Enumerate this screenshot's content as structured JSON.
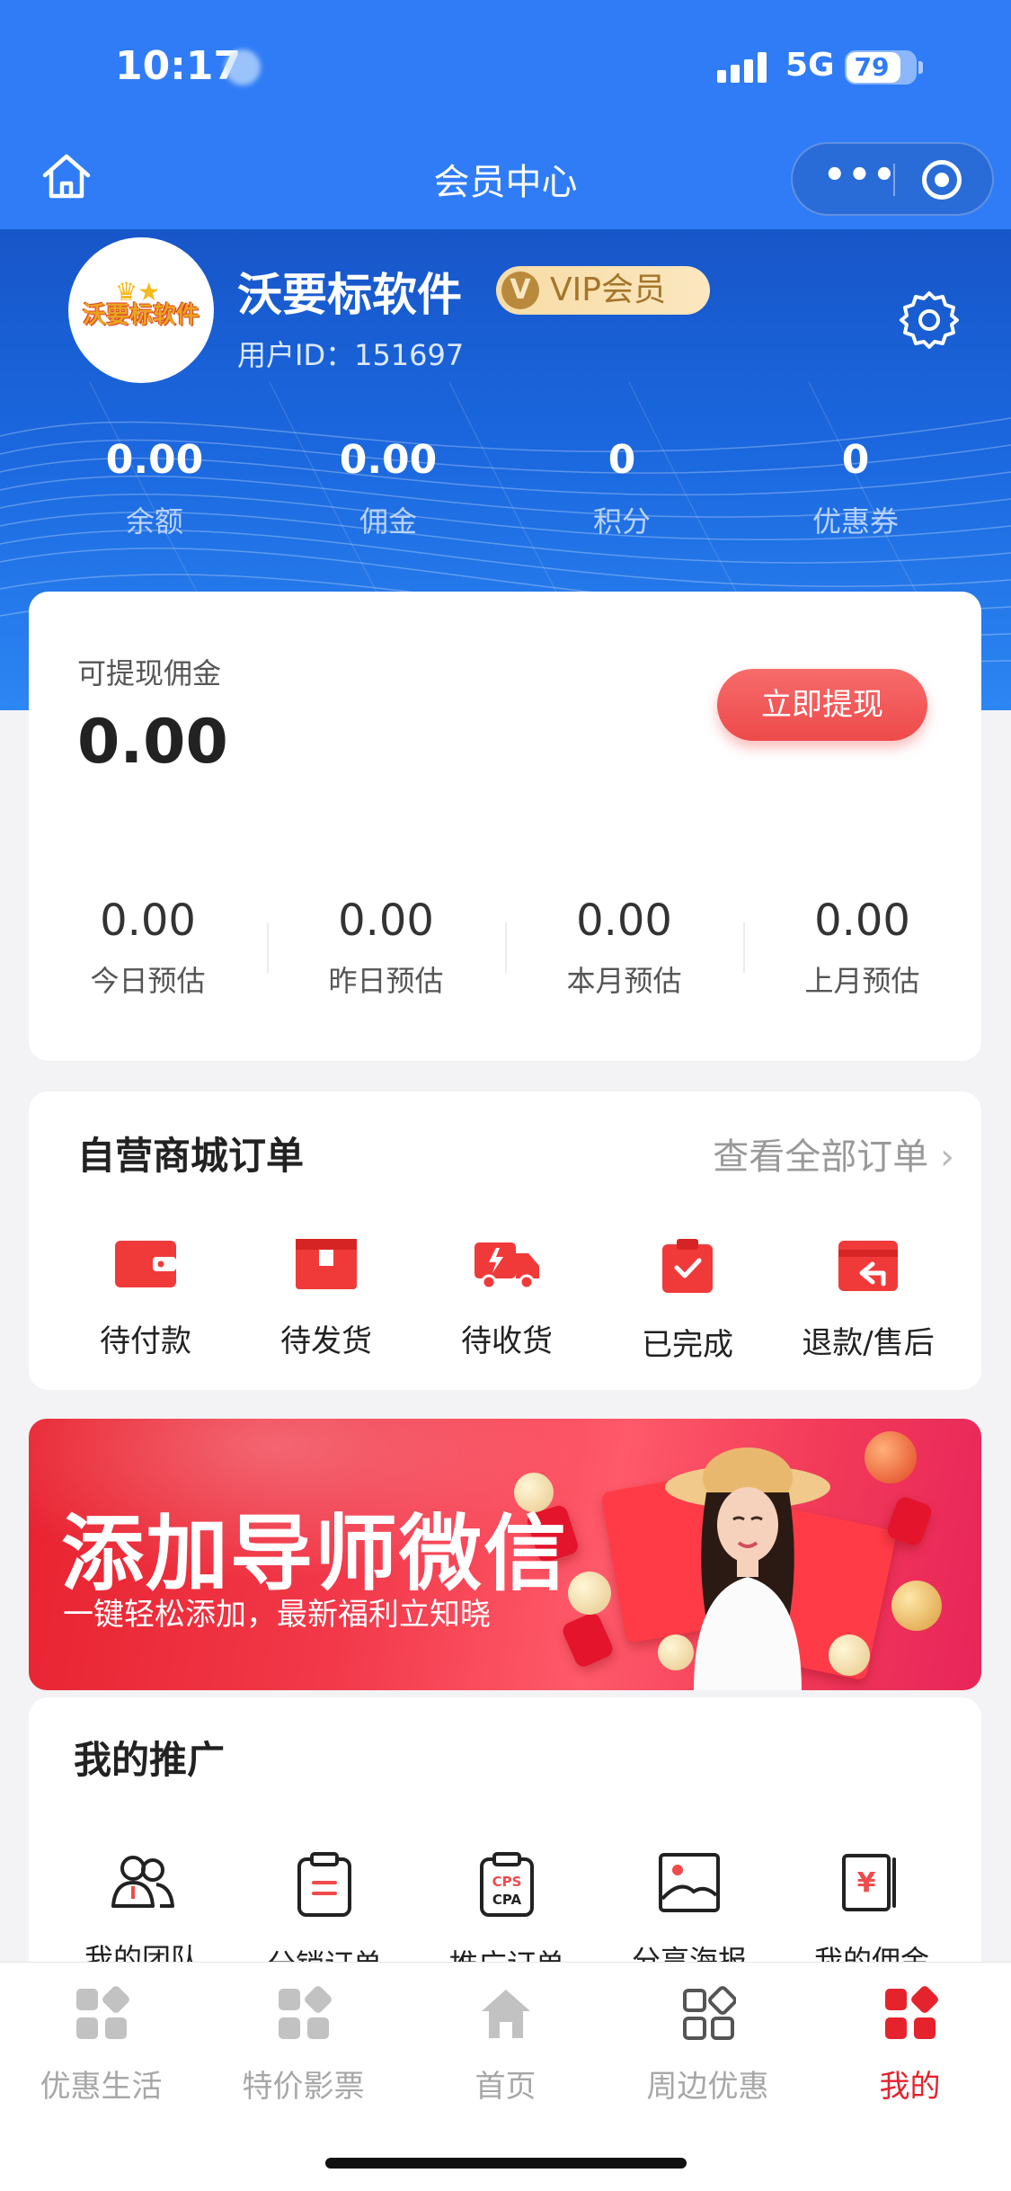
{
  "status_bar": {
    "time": "10:17",
    "network": "5G",
    "battery": "79",
    "battery_level": 0.79
  },
  "header": {
    "title": "会员中心"
  },
  "profile": {
    "avatar_text": "沃要标软件",
    "name": "沃要标软件",
    "vip_label": "VIP会员",
    "vip_letter": "V",
    "user_id": "用户ID：151697"
  },
  "stats": [
    {
      "value": "0.00",
      "label": "余额"
    },
    {
      "value": "0.00",
      "label": "佣金"
    },
    {
      "value": "0",
      "label": "积分"
    },
    {
      "value": "0",
      "label": "优惠券"
    }
  ],
  "commission": {
    "label": "可提现佣金",
    "amount": "0.00",
    "withdraw_button": "立即提现",
    "estimates": [
      {
        "value": "0.00",
        "label": "今日预估"
      },
      {
        "value": "0.00",
        "label": "昨日预估"
      },
      {
        "value": "0.00",
        "label": "本月预估"
      },
      {
        "value": "0.00",
        "label": "上月预估"
      }
    ]
  },
  "orders": {
    "title": "自营商城订单",
    "view_all": "查看全部订单",
    "items": [
      {
        "label": "待付款",
        "icon": "wallet-icon"
      },
      {
        "label": "待发货",
        "icon": "box-icon"
      },
      {
        "label": "待收货",
        "icon": "truck-icon"
      },
      {
        "label": "已完成",
        "icon": "clipboard-check-icon"
      },
      {
        "label": "退款/售后",
        "icon": "refund-icon"
      }
    ]
  },
  "banner": {
    "title": "添加导师微信",
    "subtitle": "一键轻松添加，最新福利立知晓"
  },
  "promotion": {
    "title": "我的推广",
    "items": [
      {
        "label": "我的团队",
        "icon": "team-icon"
      },
      {
        "label": "分销订单",
        "icon": "clipboard-icon"
      },
      {
        "label": "推广订单",
        "icon": "cps-cpa-icon",
        "icon_text_1": "CPS",
        "icon_text_2": "CPA"
      },
      {
        "label": "分享海报",
        "icon": "poster-icon"
      },
      {
        "label": "我的佣金",
        "icon": "yen-book-icon",
        "icon_text": "¥"
      }
    ]
  },
  "tabbar": {
    "items": [
      {
        "label": "优惠生活",
        "icon": "grid-icon"
      },
      {
        "label": "特价影票",
        "icon": "grid-icon"
      },
      {
        "label": "首页",
        "icon": "home-icon"
      },
      {
        "label": "周边优惠",
        "icon": "grid-outline-icon"
      },
      {
        "label": "我的",
        "icon": "grid-icon",
        "active": true
      }
    ],
    "active_color": "#e5232d"
  },
  "colors": {
    "primary_blue": "#2f7cf6",
    "accent_red": "#ee4a4a",
    "vip_gold": "#f7dca5"
  }
}
